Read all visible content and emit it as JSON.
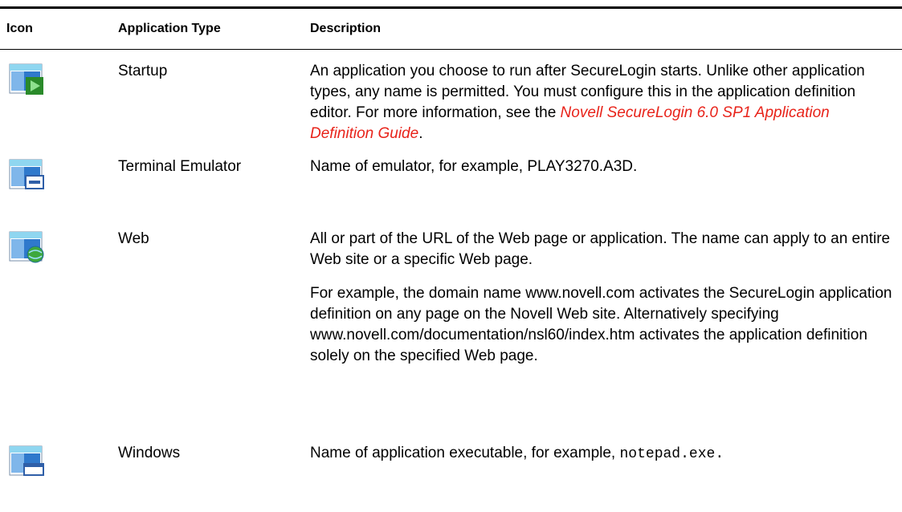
{
  "table": {
    "headers": {
      "icon": "Icon",
      "type": "Application Type",
      "description": "Description"
    },
    "rows": [
      {
        "icon": "folder-startup-icon",
        "type": "Startup",
        "description_pre": "An application you choose to run after SecureLogin starts. Unlike other application types, any name is permitted. You must configure this in the application definition editor. For more information, see the ",
        "description_link": "Novell SecureLogin 6.0 SP1 Application Definition Guide",
        "description_post": "."
      },
      {
        "icon": "folder-terminal-emulator-icon",
        "type": "Terminal Emulator",
        "description": "Name of emulator, for example, PLAY3270.A3D."
      },
      {
        "icon": "folder-web-icon",
        "type": "Web",
        "description_p1": "All or part of the URL of the Web page or application. The name can apply to an entire Web site or a specific Web page.",
        "description_p2": "For example, the domain name www.novell.com activates the SecureLogin application definition on any page on the Novell Web site. Alternatively specifying www.novell.com/documentation/nsl60/index.htm activates the application definition solely on the specified Web page."
      },
      {
        "icon": "folder-windows-icon",
        "type": "Windows",
        "description_pre": "Name of application executable, for example, ",
        "description_code": "notepad.exe",
        "description_post": "."
      }
    ]
  },
  "colors": {
    "link": "#e8231a",
    "rule": "#000000",
    "folder_blue": "#3a7fd0",
    "folder_cyan": "#8fd6f0",
    "startup_green": "#2a8a2a"
  }
}
